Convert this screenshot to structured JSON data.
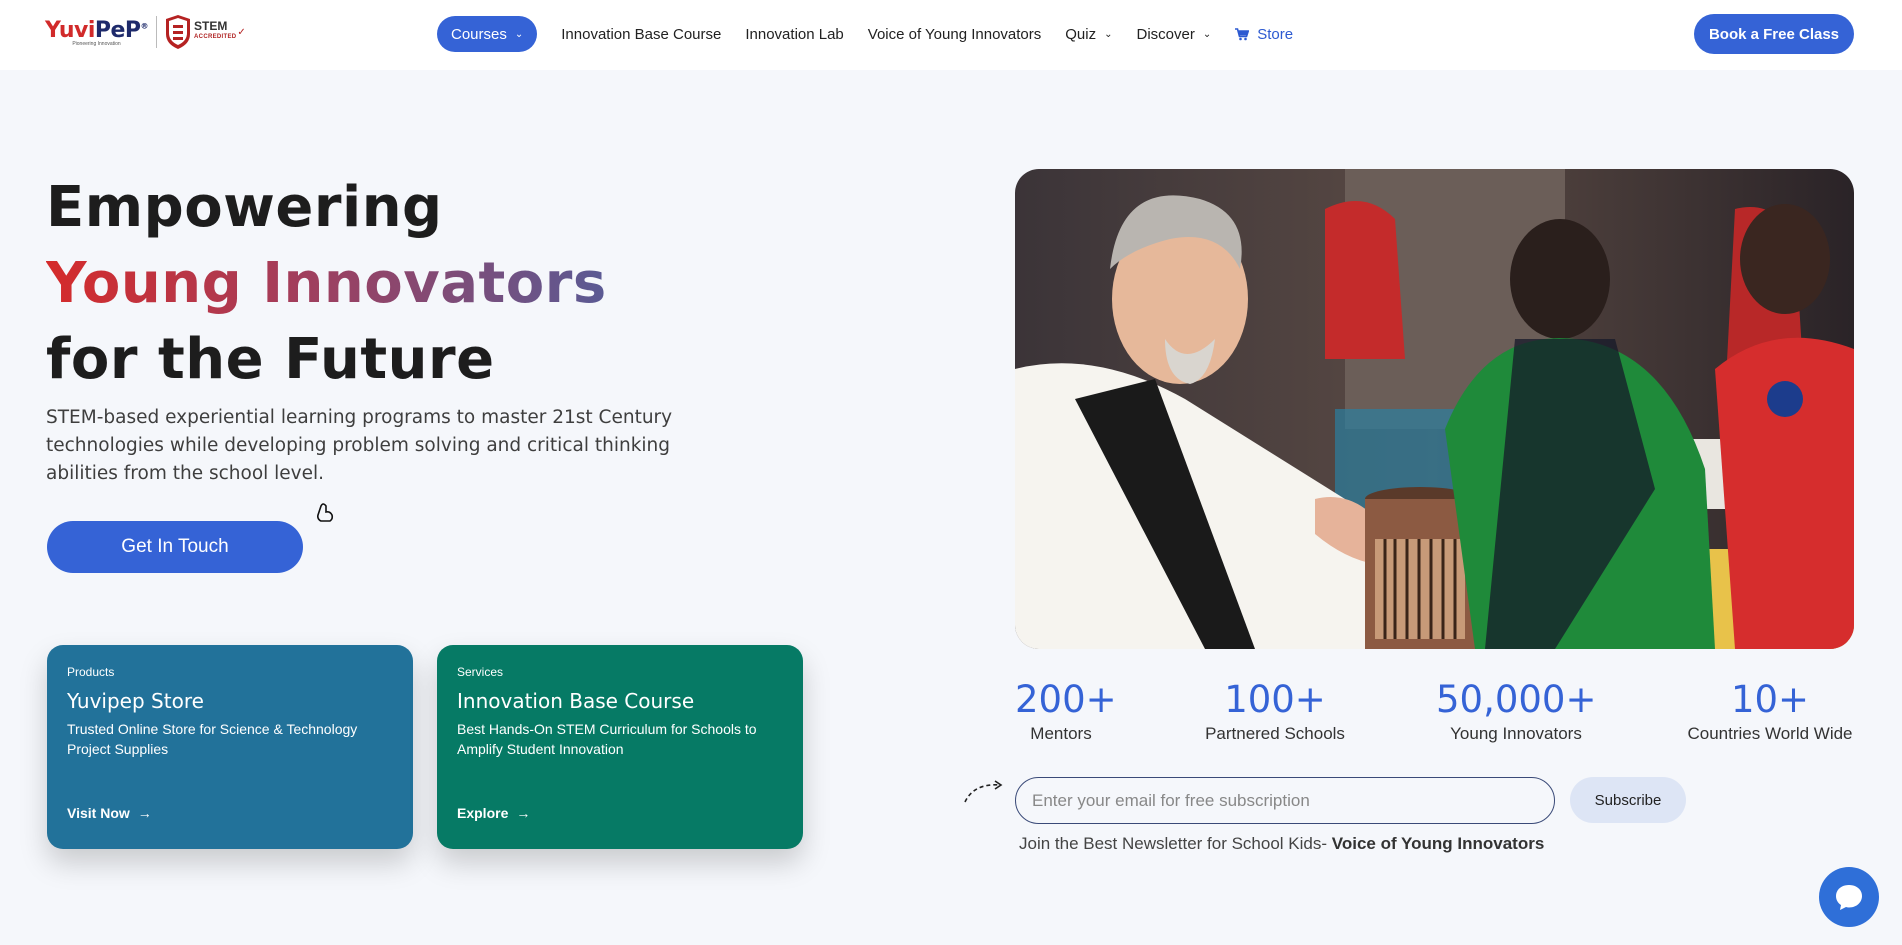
{
  "header": {
    "logo_left": "Yuvi",
    "logo_right": "PeP",
    "logo_reg": "®",
    "logo_tagline": "Pioneering Innovation",
    "stem_title": "STEM",
    "stem_sub": "ACCREDITED",
    "nav": {
      "courses": "Courses",
      "innovation_base": "Innovation Base Course",
      "innovation_lab": "Innovation Lab",
      "voice": "Voice of Young Innovators",
      "quiz": "Quiz",
      "discover": "Discover",
      "store": "Store"
    },
    "cta": "Book a Free Class"
  },
  "hero": {
    "title_line1": "Empowering",
    "title_line2": "Young Innovators",
    "title_line3": "for the Future",
    "description": "STEM-based experiential learning programs to master 21st Century technologies while developing problem solving and critical thinking abilities from the school level.",
    "button": "Get In Touch"
  },
  "cards": [
    {
      "tag": "Products",
      "title": "Yuvipep Store",
      "description": "Trusted Online Store for Science & Technology Project Supplies",
      "link": "Visit Now"
    },
    {
      "tag": "Services",
      "title": "Innovation Base Course",
      "description": "Best Hands-On STEM Curriculum for Schools to Amplify Student Innovation",
      "link": "Explore"
    }
  ],
  "stats": [
    {
      "value": "200+",
      "label": "Mentors"
    },
    {
      "value": "100+",
      "label": "Partnered Schools"
    },
    {
      "value": "50,000+",
      "label": "Young Innovators"
    },
    {
      "value": "10+",
      "label": "Countries World Wide"
    }
  ],
  "subscribe": {
    "placeholder": "Enter your email for free subscription",
    "button": "Subscribe",
    "note_prefix": "Join the Best Newsletter for School Kids-",
    "note_bold": "Voice of Young Innovators"
  },
  "colors": {
    "primary": "#3563d6",
    "products_card": "#22729a",
    "services_card": "#067a65",
    "brand_red": "#d12a2a"
  },
  "icons": [
    "chevron-down-icon",
    "cart-icon",
    "arrow-right-icon",
    "chat-icon",
    "stem-shield-icon",
    "cursor-icon"
  ]
}
